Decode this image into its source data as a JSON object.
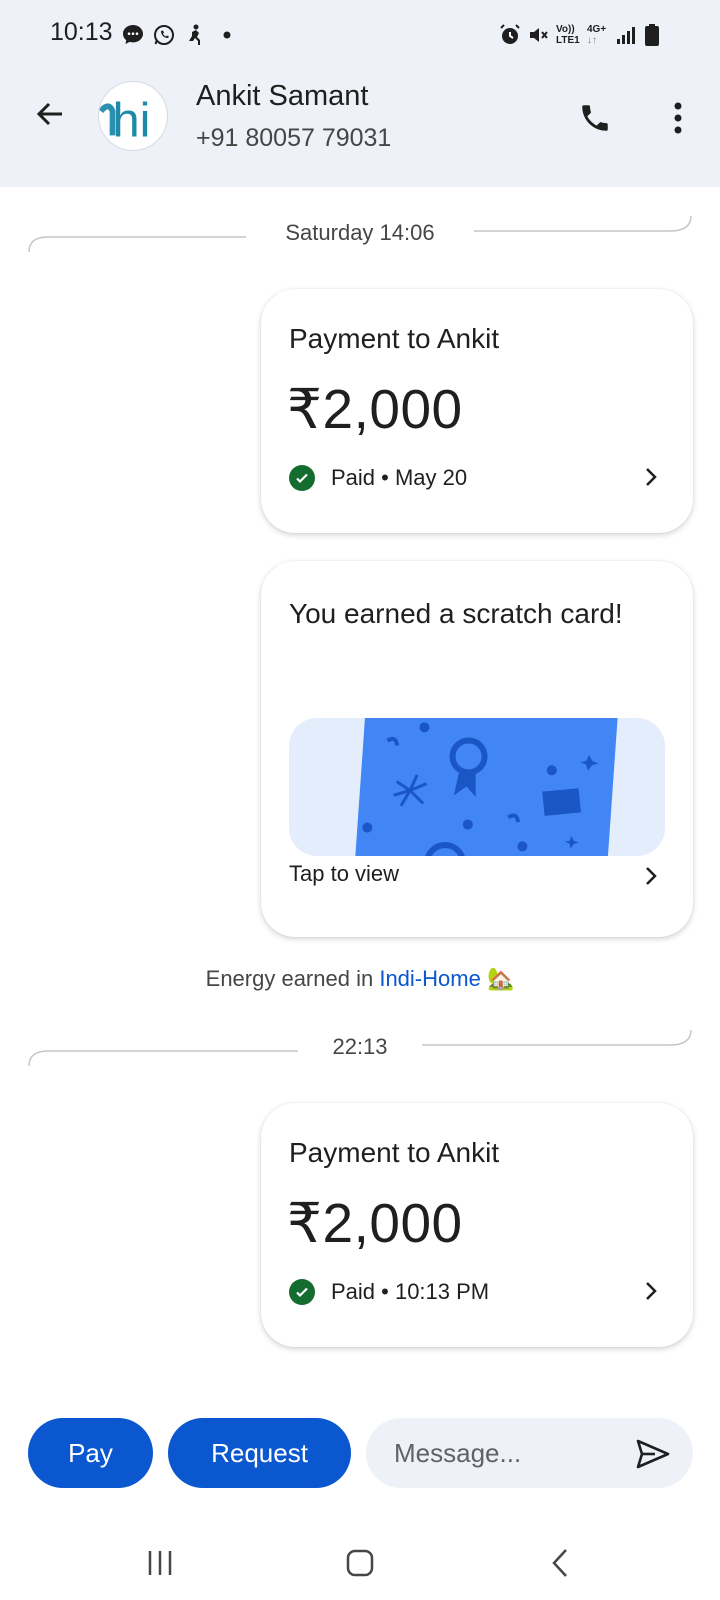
{
  "status_bar": {
    "time": "10:13",
    "left_icons": [
      "chat-bubble-icon",
      "whatsapp-icon",
      "fitness-icon",
      "dot-icon"
    ],
    "right_icons": [
      "alarm-icon",
      "mute-icon",
      "volte-icon",
      "network-4g-icon",
      "signal-icon",
      "battery-icon"
    ],
    "volte_top": "Vo))",
    "volte_bottom": "LTE1",
    "net_label": "4G+"
  },
  "header": {
    "contact_name": "Ankit Samant",
    "contact_phone": "+91 80057 79031",
    "avatar_text": "hi"
  },
  "separators": [
    {
      "label": "Saturday 14:06"
    },
    {
      "label": "22:13"
    }
  ],
  "cards": [
    {
      "title": "Payment to Ankit",
      "amount": "₹2,000",
      "status": "Paid • May 20"
    },
    {
      "title": "You earned a scratch card!",
      "action": "Tap to view"
    },
    {
      "title": "Payment to Ankit",
      "amount": "₹2,000",
      "status": "Paid • 10:13 PM"
    }
  ],
  "energy": {
    "prefix": "Energy earned in",
    "link": "Indi-Home",
    "emoji": "🏡"
  },
  "composer": {
    "pay_label": "Pay",
    "request_label": "Request",
    "message_placeholder": "Message..."
  },
  "colors": {
    "accent": "#0b57d0",
    "header_bg": "#eef2f8",
    "paid_green": "#146c2e",
    "scratch_card_blue": "#4285f4"
  }
}
